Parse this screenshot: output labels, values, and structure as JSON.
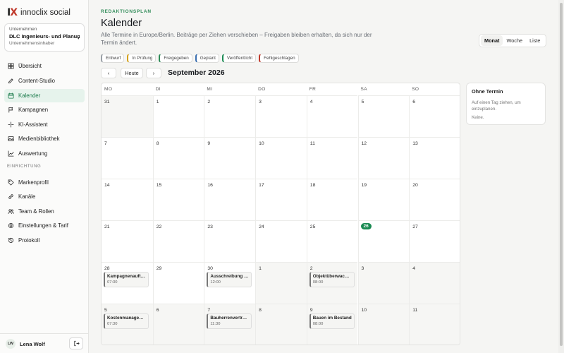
{
  "brand": {
    "mark_i": "I",
    "mark_x": "X",
    "name": "innoclix social"
  },
  "org": {
    "label": "Unternehmen",
    "name": "DLC Ingenieurs- und Planungsbüro",
    "role": "Unternehmensinhaber"
  },
  "nav": {
    "items": [
      {
        "label": "Übersicht",
        "icon": "grid-icon",
        "active": false
      },
      {
        "label": "Content-Studio",
        "icon": "pen-icon",
        "active": false
      },
      {
        "label": "Kalender",
        "icon": "calendar-icon",
        "active": true
      },
      {
        "label": "Kampagnen",
        "icon": "flag-icon",
        "active": false
      },
      {
        "label": "KI-Assistent",
        "icon": "sparkle-icon",
        "active": false
      },
      {
        "label": "Medienbibliothek",
        "icon": "image-icon",
        "active": false
      },
      {
        "label": "Auswertung",
        "icon": "chart-icon",
        "active": false
      }
    ],
    "section_label": "EINRICHTUNG",
    "settings_items": [
      {
        "label": "Markenprofil",
        "icon": "tag-icon"
      },
      {
        "label": "Kanäle",
        "icon": "link-icon"
      },
      {
        "label": "Team & Rollen",
        "icon": "users-icon"
      },
      {
        "label": "Einstellungen & Tarif",
        "icon": "gear-icon"
      },
      {
        "label": "Protokoll",
        "icon": "history-icon"
      }
    ]
  },
  "user": {
    "initials": "LW",
    "name": "Lena Wolf"
  },
  "header": {
    "eyebrow": "REDAKTIONSPLAN",
    "title": "Kalender",
    "subtitle": "Alle Termine in Europe/Berlin. Beiträge per Ziehen verschieben – Freigaben bleiben erhalten, da sich nur der Termin ändert."
  },
  "views": [
    "Monat",
    "Woche",
    "Liste"
  ],
  "active_view": "Monat",
  "legend": [
    {
      "label": "Entwurf",
      "color": "#9aa0a6"
    },
    {
      "label": "In Prüfung",
      "color": "#d4a017"
    },
    {
      "label": "Freigegeben",
      "color": "#2e8b57"
    },
    {
      "label": "Geplant",
      "color": "#3a6fb0"
    },
    {
      "label": "Veröffentlicht",
      "color": "#1a8a52"
    },
    {
      "label": "Fehlgeschlagen",
      "color": "#c0392b"
    }
  ],
  "toolbar": {
    "prev": "‹",
    "today": "Heute",
    "next": "›",
    "month_title": "September 2026"
  },
  "weekdays": [
    "MO",
    "DI",
    "MI",
    "DO",
    "FR",
    "SA",
    "SO"
  ],
  "weeks": [
    [
      {
        "d": "31",
        "o": true
      },
      {
        "d": "1"
      },
      {
        "d": "2"
      },
      {
        "d": "3"
      },
      {
        "d": "4"
      },
      {
        "d": "5"
      },
      {
        "d": "6"
      }
    ],
    [
      {
        "d": "7"
      },
      {
        "d": "8"
      },
      {
        "d": "9"
      },
      {
        "d": "10"
      },
      {
        "d": "11"
      },
      {
        "d": "12"
      },
      {
        "d": "13"
      }
    ],
    [
      {
        "d": "14"
      },
      {
        "d": "15"
      },
      {
        "d": "16"
      },
      {
        "d": "17"
      },
      {
        "d": "18"
      },
      {
        "d": "19"
      },
      {
        "d": "20"
      }
    ],
    [
      {
        "d": "21"
      },
      {
        "d": "22"
      },
      {
        "d": "23"
      },
      {
        "d": "24"
      },
      {
        "d": "25"
      },
      {
        "d": "26",
        "today": true
      },
      {
        "d": "27"
      }
    ],
    [
      {
        "d": "28",
        "ev": {
          "title": "Kampagnenauftakt",
          "time": "07:30"
        }
      },
      {
        "d": "29"
      },
      {
        "d": "30",
        "ev": {
          "title": "Ausschreibung und Vergabe",
          "time": "12:00"
        }
      },
      {
        "d": "1",
        "o": true
      },
      {
        "d": "2",
        "o": true,
        "ev": {
          "title": "Objektüberwachung",
          "time": "08:00"
        }
      },
      {
        "d": "3",
        "o": true
      },
      {
        "d": "4",
        "o": true
      }
    ],
    [
      {
        "d": "5",
        "o": true,
        "ev": {
          "title": "Kostenmanagement",
          "time": "07:30"
        }
      },
      {
        "d": "6",
        "o": true
      },
      {
        "d": "7",
        "o": true,
        "ev": {
          "title": "Bauherrenvertretung",
          "time": "11:30"
        }
      },
      {
        "d": "8",
        "o": true
      },
      {
        "d": "9",
        "o": true,
        "ev": {
          "title": "Bauen im Bestand",
          "time": "08:00"
        }
      },
      {
        "d": "10",
        "o": true
      },
      {
        "d": "11",
        "o": true
      }
    ]
  ],
  "panel": {
    "title": "Ohne Termin",
    "hint": "Auf einen Tag ziehen, um einzuplanen.",
    "empty": "Keine."
  }
}
